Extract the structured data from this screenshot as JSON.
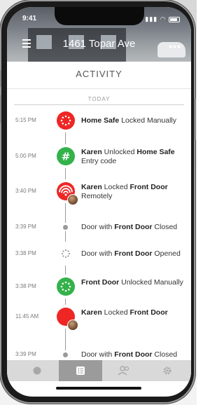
{
  "status_bar": {
    "time": "9:41"
  },
  "header": {
    "title": "1461 Topar Ave"
  },
  "section": {
    "title": "ACTIVITY",
    "group": "TODAY"
  },
  "events": [
    {
      "time": "5:15 PM",
      "parts": [
        {
          "b": true,
          "t": "Home Safe"
        },
        {
          "b": false,
          "t": " Locked Manually"
        }
      ],
      "icon": "lock-dots-icon",
      "color": "#ee2624"
    },
    {
      "time": "5:00 PM",
      "parts": [
        {
          "b": true,
          "t": "Karen"
        },
        {
          "b": false,
          "t": " Unlocked "
        },
        {
          "b": true,
          "t": "Home Safe"
        },
        {
          "b": false,
          "t": " Entry code"
        }
      ],
      "icon": "hash-icon",
      "color": "#33b24a"
    },
    {
      "time": "3:40 PM",
      "parts": [
        {
          "b": true,
          "t": "Karen"
        },
        {
          "b": false,
          "t": " Locked "
        },
        {
          "b": true,
          "t": "Front Door"
        },
        {
          "b": false,
          "t": " Remotely"
        }
      ],
      "icon": "wifi-icon",
      "color": "#ee2624"
    },
    {
      "time": "3:39 PM",
      "parts": [
        {
          "b": false,
          "t": "Door with "
        },
        {
          "b": true,
          "t": "Front Door"
        },
        {
          "b": false,
          "t": " Closed"
        }
      ],
      "icon": "dot-icon",
      "color": "#9a9a9a"
    },
    {
      "time": "3:38 PM",
      "parts": [
        {
          "b": false,
          "t": "Door with "
        },
        {
          "b": true,
          "t": "Front Door"
        },
        {
          "b": false,
          "t": " Opened"
        }
      ],
      "icon": "dotted-ring-icon",
      "color": "#9a9a9a"
    },
    {
      "time": "3:38 PM",
      "parts": [
        {
          "b": true,
          "t": "Front Door"
        },
        {
          "b": false,
          "t": " Unlocked Manually"
        }
      ],
      "icon": "lock-dots-icon",
      "color": "#33b24a"
    },
    {
      "time": "11:45 AM",
      "parts": [
        {
          "b": true,
          "t": "Karen"
        },
        {
          "b": false,
          "t": " Locked "
        },
        {
          "b": true,
          "t": "Front Door"
        }
      ],
      "icon": "lock-icon",
      "color": "#ee2624"
    },
    {
      "time": "3:39 PM",
      "parts": [
        {
          "b": false,
          "t": "Door with "
        },
        {
          "b": true,
          "t": "Front Door"
        },
        {
          "b": false,
          "t": " Closed"
        }
      ],
      "icon": "dot-icon",
      "color": "#9a9a9a"
    }
  ],
  "tabs": [
    {
      "name": "home",
      "icon": "circle-icon"
    },
    {
      "name": "activity",
      "icon": "list-icon",
      "active": true
    },
    {
      "name": "users",
      "icon": "users-icon"
    },
    {
      "name": "settings",
      "icon": "gear-icon"
    }
  ],
  "colors": {
    "red": "#ee2624",
    "green": "#33b24a",
    "tab_active": "#9b9b9b"
  }
}
